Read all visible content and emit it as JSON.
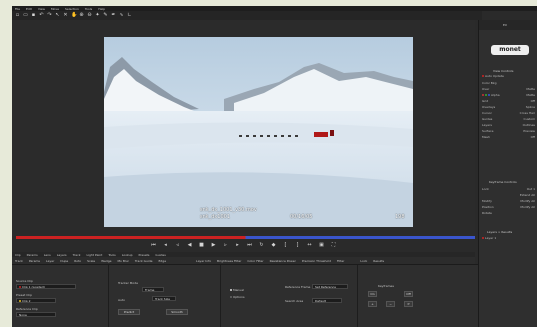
{
  "menu": [
    "File",
    "Edit",
    "View",
    "Move",
    "Selection",
    "Tools",
    "Help"
  ],
  "toolbar_icons": [
    "new-file-icon",
    "open-folder-icon",
    "save-icon",
    "undo-icon",
    "redo-icon",
    "select-arrow-icon",
    "transform-icon",
    "hand-icon",
    "zoom-in-icon",
    "zoom-out-icon",
    "magic-wand-icon",
    "brush-icon",
    "pen-icon",
    "path-icon",
    "corner-icon"
  ],
  "viewer": {
    "filename": "snk_dx_1001_v30.mov",
    "slate": "snk_dx1001",
    "timecode": "00/16/05",
    "frame_number": "198"
  },
  "right_panel": {
    "top_label": "EX",
    "logo": "monet",
    "section1": {
      "title": "View Controls",
      "auto_label": "Auto Update"
    },
    "rows1": [
      {
        "label": "Color Bkg",
        "value": ""
      },
      {
        "label": "Over",
        "value": "Matte"
      },
      {
        "label": "Alpha",
        "value": "Matte"
      },
      {
        "label": "Grid",
        "value": "Off"
      },
      {
        "label": "Overlays",
        "value": "Spline"
      },
      {
        "label": "Cursor",
        "value": "Cross Hair"
      },
      {
        "label": "Guides",
        "value": "Custom"
      },
      {
        "label": "Layers",
        "value": "Outlines"
      },
      {
        "label": "Surface",
        "value": "Preview"
      },
      {
        "label": "Mesh",
        "value": "Off"
      }
    ],
    "section2": {
      "title": "Keyframe Controls"
    },
    "rows2": [
      {
        "label": "Lock",
        "value": "Out 1"
      },
      {
        "label": "",
        "value": "Extend All"
      },
      {
        "label": "Modify",
        "value": "Modify All"
      },
      {
        "label": "Position",
        "value": "Modify All"
      },
      {
        "label": "Rotate",
        "value": ""
      }
    ],
    "section3": {
      "title": "Layers > Results"
    },
    "layer_item": "Layer 1"
  },
  "transport_icons": [
    "first-frame-icon",
    "prev-key-icon",
    "step-back-icon",
    "play-reverse-icon",
    "stop-icon",
    "play-icon",
    "step-forward-icon",
    "next-key-icon",
    "last-frame-icon",
    "loop-icon",
    "marker-icon",
    "in-point-icon",
    "out-point-icon",
    "range-icon",
    "fit-icon",
    "fullscreen-icon"
  ],
  "tabs1": [
    "Clip",
    "Params",
    "Lens",
    "Layers",
    "Track",
    "Light Paint",
    "Tools",
    "Lookup",
    "Presets",
    "Guides"
  ],
  "tabs2": [
    "Track",
    "Params",
    "Layer",
    "Dupe",
    "Roto",
    "Scale",
    "Wedge",
    "Mo Blur",
    "Track Guide",
    "Edge",
    "Layer Info",
    "Brightness Filter",
    "Color Filter",
    "Resistance Power",
    "Precision Threshold",
    "Filter",
    "Lock",
    "Results"
  ],
  "bottom": {
    "source_clip_label": "Source Clip",
    "source_clip_value": "Clip 1 (Loaded)",
    "preset_clip_label": "Preset Clip",
    "preset_clip_value": "Clip 2",
    "reference_label": "Reference Clip",
    "reference_value": "None",
    "track_type": "Tracker Mode",
    "track_from": "Frame",
    "track_to": "Track Size",
    "prediction": "Predict",
    "smooth": "Smooth",
    "auto_label": "Auto",
    "manual_label": "Manual",
    "options_label": "Options",
    "search_label": "Reference Frame",
    "search_value": "Set Reference",
    "area_label": "Search Area",
    "area_value": "Default",
    "key_label": "Keyframes",
    "on_label": "On",
    "off_label": "Off"
  }
}
